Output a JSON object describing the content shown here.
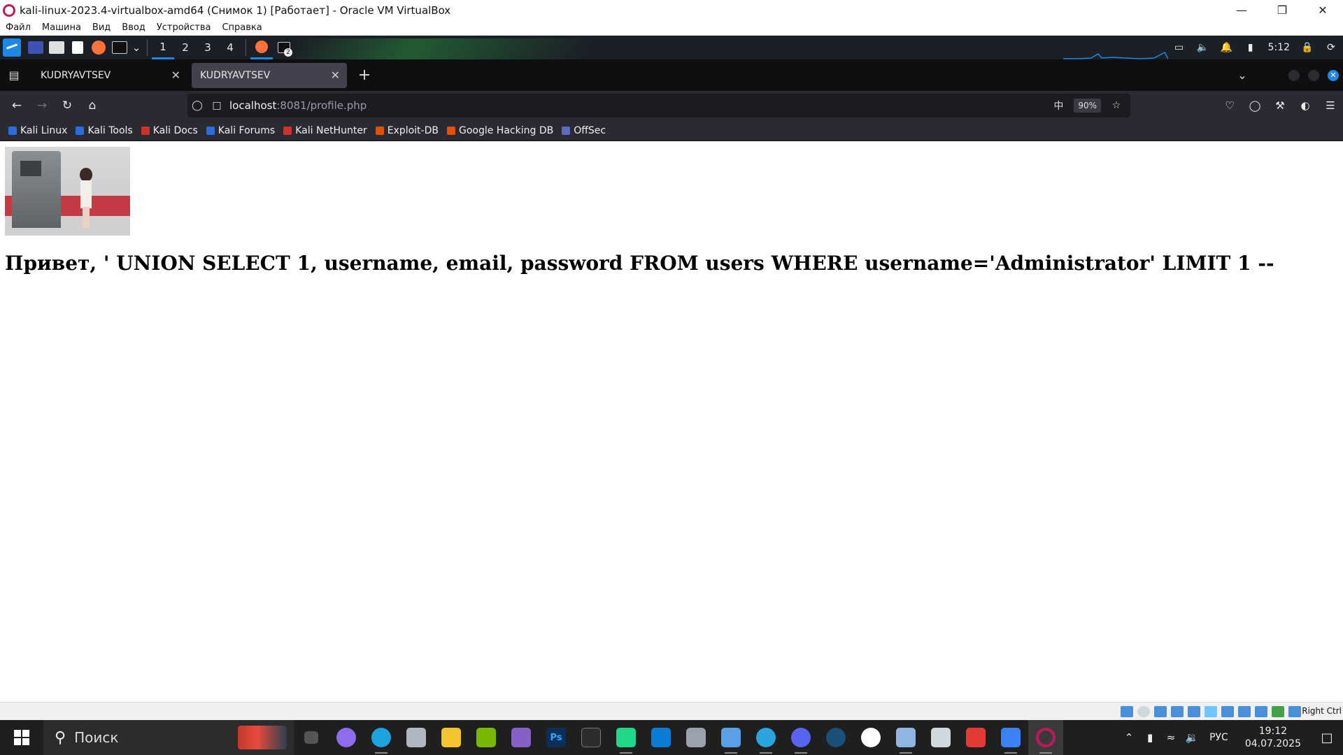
{
  "vbox": {
    "title": "kali-linux-2023.4-virtualbox-amd64 (Снимок 1) [Работает] - Oracle VM VirtualBox",
    "menu": [
      "Файл",
      "Машина",
      "Вид",
      "Ввод",
      "Устройства",
      "Справка"
    ],
    "host_key": "Right Ctrl"
  },
  "kali_panel": {
    "workspaces": [
      "1",
      "2",
      "3",
      "4"
    ],
    "active_workspace": "1",
    "clock": "5:12",
    "terminal_badge": "2"
  },
  "firefox": {
    "tabs": [
      {
        "title": "KUDRYAVTSEV",
        "selected": false
      },
      {
        "title": "KUDRYAVTSEV",
        "selected": true
      }
    ],
    "url_host": "localhost",
    "url_rest": ":8081/profile.php",
    "zoom": "90%",
    "bookmarks": [
      {
        "label": "Kali Linux",
        "color": "#2d6cdf"
      },
      {
        "label": "Kali Tools",
        "color": "#2d6cdf"
      },
      {
        "label": "Kali Docs",
        "color": "#d32f2f"
      },
      {
        "label": "Kali Forums",
        "color": "#2d6cdf"
      },
      {
        "label": "Kali NetHunter",
        "color": "#d32f2f"
      },
      {
        "label": "Exploit-DB",
        "color": "#e65100"
      },
      {
        "label": "Google Hacking DB",
        "color": "#e65100"
      },
      {
        "label": "OffSec",
        "color": "#5c6bc0"
      }
    ]
  },
  "page": {
    "greeting": "Привет, ' UNION SELECT 1, username, email, password FROM users WHERE username='Administrator' LIMIT 1 --"
  },
  "taskbar": {
    "search_placeholder": "Поиск",
    "apps": [
      {
        "name": "task-view",
        "color": "#555"
      },
      {
        "name": "alice",
        "color": "#8e6cf0"
      },
      {
        "name": "edge",
        "color": "#1fa3e0"
      },
      {
        "name": "app-box",
        "color": "#b0b7c0"
      },
      {
        "name": "file-explorer",
        "color": "#f4c430"
      },
      {
        "name": "nvidia",
        "color": "#76b900"
      },
      {
        "name": "visual-studio",
        "color": "#8661c5"
      },
      {
        "name": "photoshop",
        "color": "#0b2f5a"
      },
      {
        "name": "terminal",
        "color": "#2d2d2d"
      },
      {
        "name": "pycharm",
        "color": "#21d789"
      },
      {
        "name": "vscode",
        "color": "#0a7cd6"
      },
      {
        "name": "database",
        "color": "#9aa3ad"
      },
      {
        "name": "virtualbox-cube",
        "color": "#5aa0e6"
      },
      {
        "name": "telegram",
        "color": "#2aa3e0"
      },
      {
        "name": "discord",
        "color": "#5865f2"
      },
      {
        "name": "steam",
        "color": "#1b4f7a"
      },
      {
        "name": "yandex-browser",
        "color": "#ffffff"
      },
      {
        "name": "image-viewer",
        "color": "#8fb6e0"
      },
      {
        "name": "spreadsheet",
        "color": "#cfd8dc"
      },
      {
        "name": "t-app",
        "color": "#e53935"
      },
      {
        "name": "paint",
        "color": "#3b82f6"
      },
      {
        "name": "vbox-app",
        "color": "#c2185b"
      }
    ],
    "lang": "РУС",
    "time": "19:12",
    "date": "04.07.2025"
  }
}
